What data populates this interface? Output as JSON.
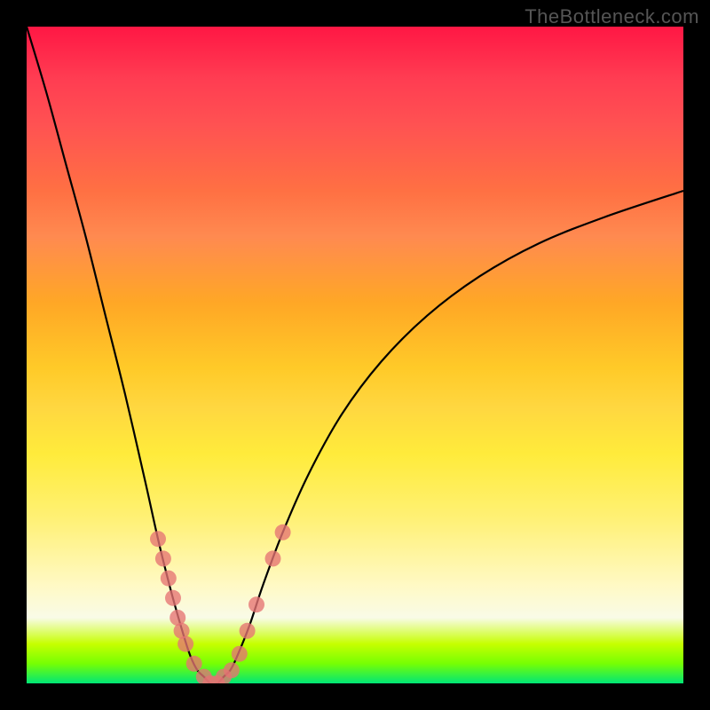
{
  "watermark": "TheBottleneck.com",
  "chart_data": {
    "type": "line",
    "title": "",
    "xlabel": "",
    "ylabel": "",
    "xlim": [
      0,
      100
    ],
    "ylim": [
      0,
      100
    ],
    "grid": false,
    "background_gradient": {
      "direction": "vertical",
      "stops": [
        {
          "pos": 0.0,
          "color": "#ff1744"
        },
        {
          "pos": 0.15,
          "color": "#ff5252"
        },
        {
          "pos": 0.32,
          "color": "#ff8a50"
        },
        {
          "pos": 0.52,
          "color": "#ffca28"
        },
        {
          "pos": 0.7,
          "color": "#ffee58"
        },
        {
          "pos": 0.85,
          "color": "#fff9c4"
        },
        {
          "pos": 0.97,
          "color": "#76ff03"
        },
        {
          "pos": 1.0,
          "color": "#00e676"
        }
      ]
    },
    "series": [
      {
        "name": "bottleneck-curve",
        "x": [
          0,
          3,
          6,
          9,
          12,
          15,
          18,
          20,
          22,
          24,
          25,
          26,
          27,
          28,
          29,
          30,
          31,
          32,
          34,
          36,
          39,
          43,
          48,
          54,
          61,
          69,
          78,
          88,
          100
        ],
        "y": [
          100,
          90,
          79,
          68,
          56,
          44,
          31,
          22,
          14,
          7,
          4,
          2,
          1,
          0,
          0,
          1,
          2,
          4,
          9,
          15,
          23,
          32,
          41,
          49,
          56,
          62,
          67,
          71,
          75
        ]
      }
    ],
    "markers": [
      {
        "x": 20.0,
        "y": 22
      },
      {
        "x": 20.8,
        "y": 19
      },
      {
        "x": 21.6,
        "y": 16
      },
      {
        "x": 22.3,
        "y": 13
      },
      {
        "x": 23.0,
        "y": 10
      },
      {
        "x": 23.6,
        "y": 8
      },
      {
        "x": 24.2,
        "y": 6
      },
      {
        "x": 25.5,
        "y": 3
      },
      {
        "x": 27.0,
        "y": 1
      },
      {
        "x": 28.0,
        "y": 0
      },
      {
        "x": 29.0,
        "y": 0
      },
      {
        "x": 30.0,
        "y": 1
      },
      {
        "x": 31.2,
        "y": 2
      },
      {
        "x": 32.4,
        "y": 4.5
      },
      {
        "x": 33.6,
        "y": 8
      },
      {
        "x": 35.0,
        "y": 12
      },
      {
        "x": 37.5,
        "y": 19
      },
      {
        "x": 39.0,
        "y": 23
      }
    ],
    "marker_style": {
      "color": "#e57373",
      "radius": 9
    }
  }
}
